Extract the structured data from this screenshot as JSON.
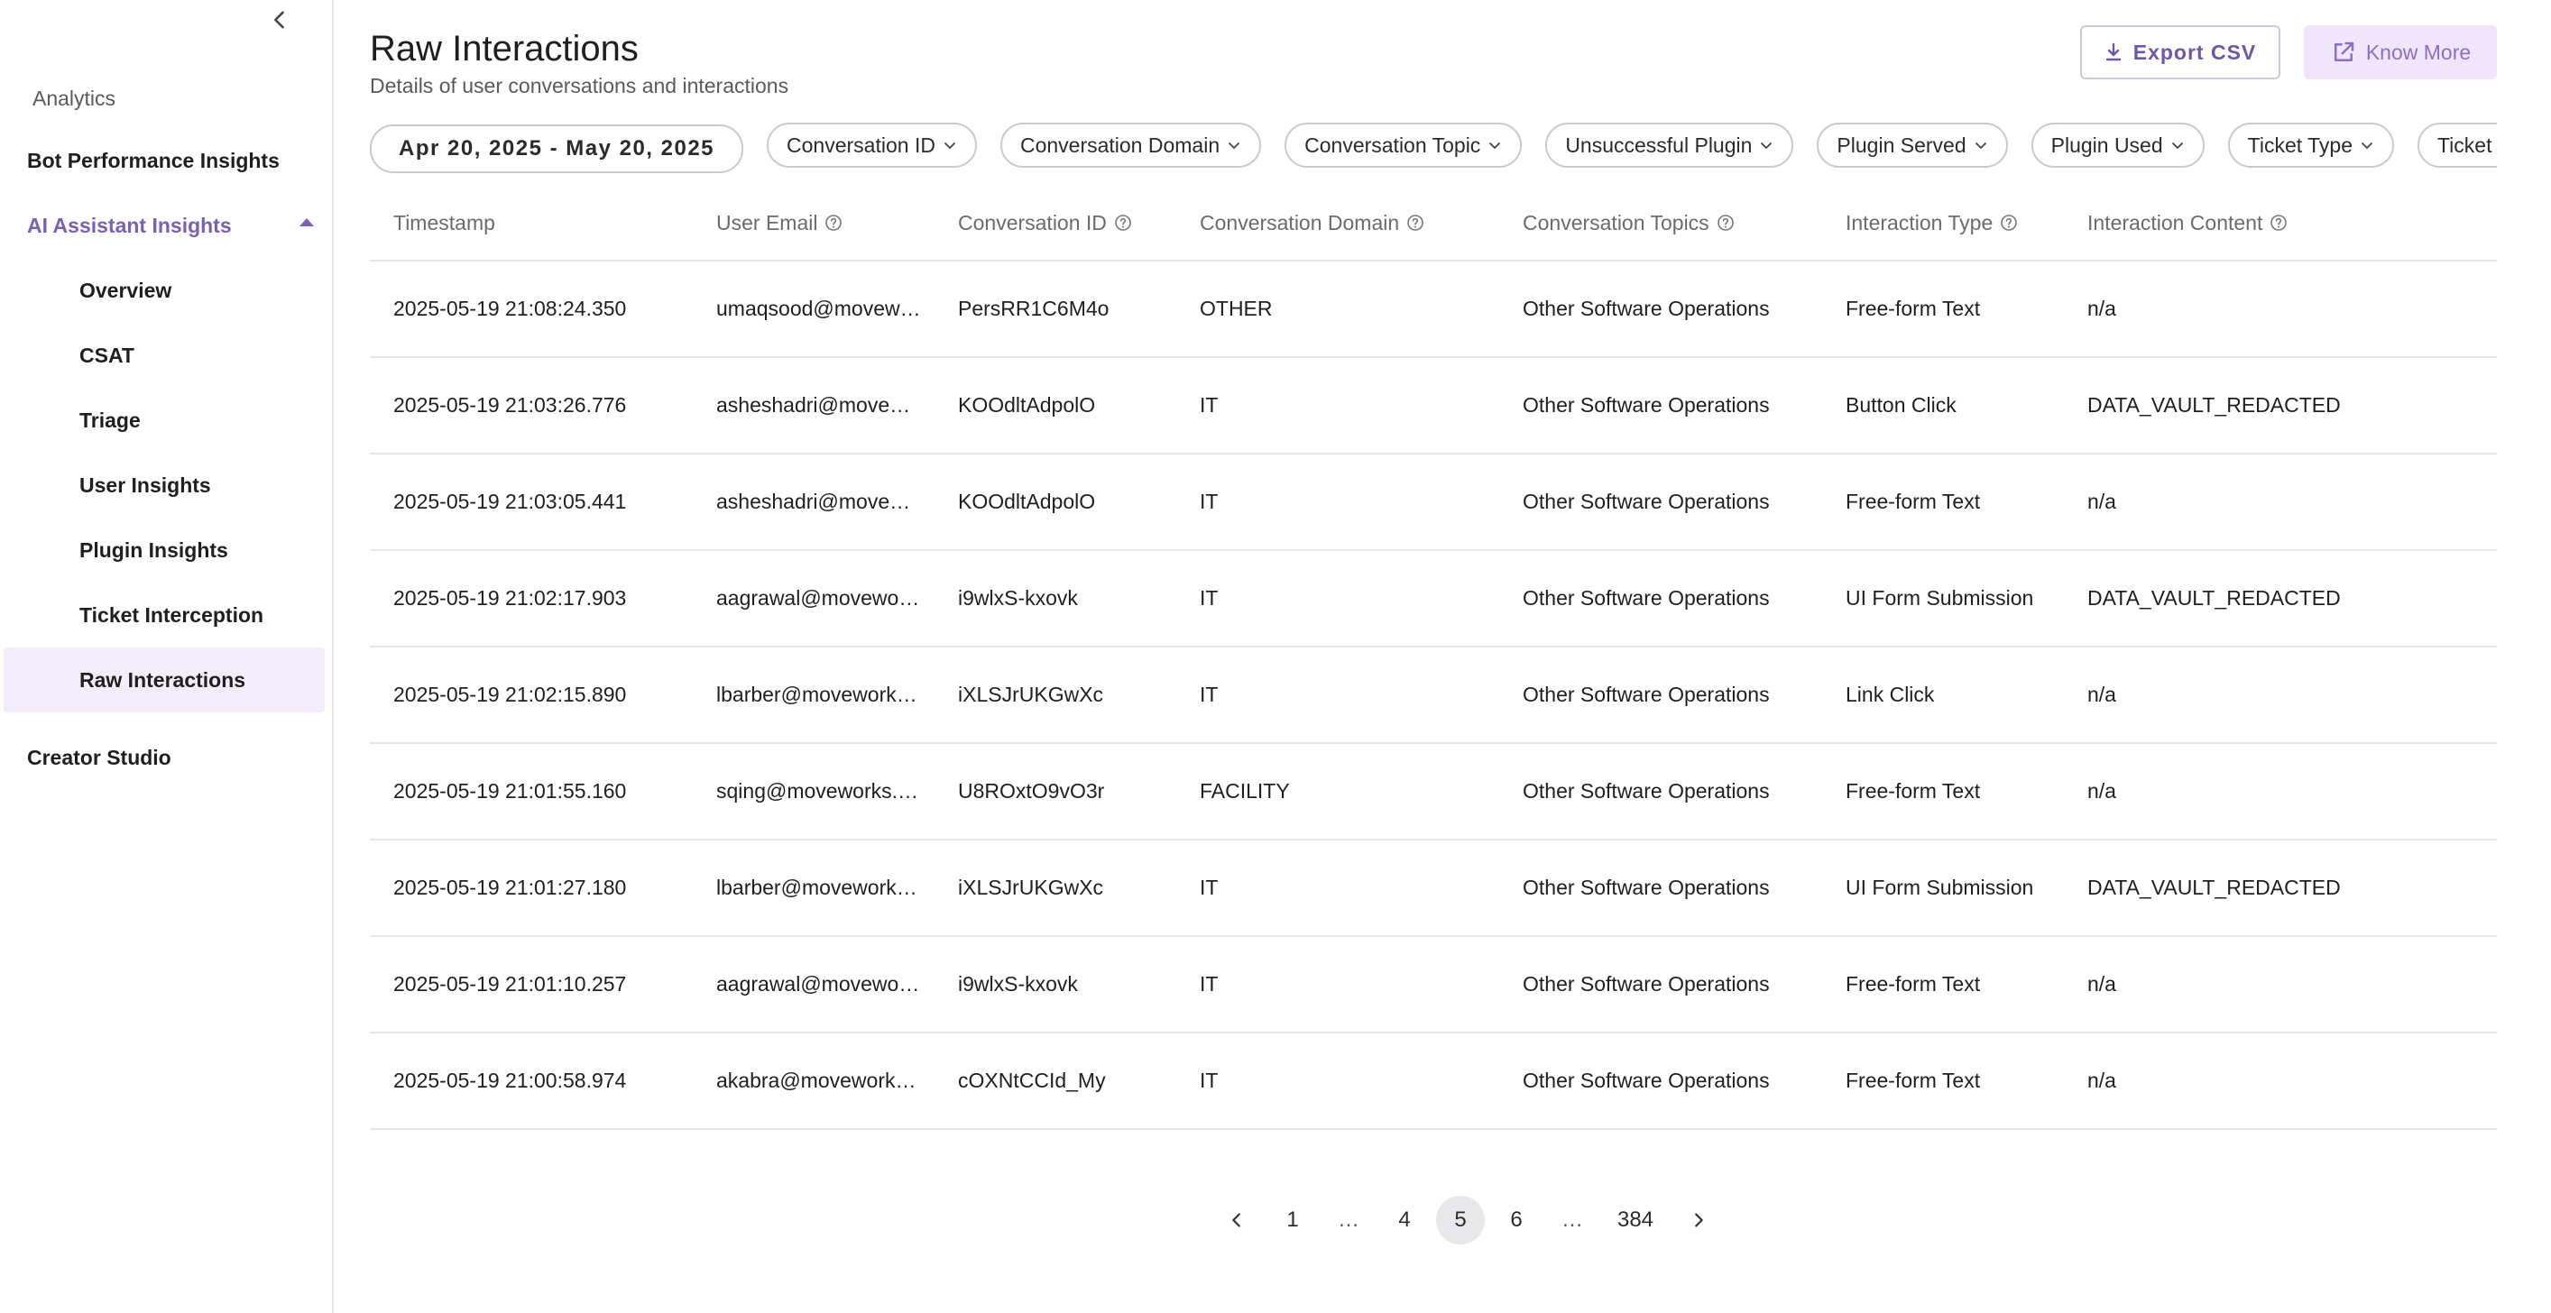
{
  "sidebar": {
    "section_label": "Analytics",
    "items": [
      {
        "label": "Bot Performance Insights"
      },
      {
        "label": "AI Assistant Insights"
      },
      {
        "label": "Overview"
      },
      {
        "label": "CSAT"
      },
      {
        "label": "Triage"
      },
      {
        "label": "User Insights"
      },
      {
        "label": "Plugin Insights"
      },
      {
        "label": "Ticket Interception"
      },
      {
        "label": "Raw Interactions"
      },
      {
        "label": "Creator Studio"
      }
    ],
    "active_item": "Raw Interactions",
    "accent_color": "#7b5fb3"
  },
  "header": {
    "title": "Raw Interactions",
    "subtitle": "Details of user conversations and interactions",
    "export_label": "Export CSV",
    "know_more_label": "Know More"
  },
  "filters": {
    "date_range": "Apr 20, 2025 - May 20, 2025",
    "chips": [
      "Conversation ID",
      "Conversation Domain",
      "Conversation Topic",
      "Unsuccessful Plugin",
      "Plugin Served",
      "Plugin Used",
      "Ticket Type",
      "Ticket ID"
    ]
  },
  "table": {
    "columns": [
      "Timestamp",
      "User Email",
      "Conversation ID",
      "Conversation Domain",
      "Conversation Topics",
      "Interaction Type",
      "Interaction Content"
    ],
    "rows": [
      [
        "2025-05-19 21:08:24.350",
        "umaqsood@moveworks.com",
        "PersRR1C6M4o",
        "OTHER",
        "Other Software Operations",
        "Free-form Text",
        "n/a"
      ],
      [
        "2025-05-19 21:03:26.776",
        "asheshadri@moveworks.com",
        "KOOdltAdpolO",
        "IT",
        "Other Software Operations",
        "Button Click",
        "DATA_VAULT_REDACTED"
      ],
      [
        "2025-05-19 21:03:05.441",
        "asheshadri@moveworks.com",
        "KOOdltAdpolO",
        "IT",
        "Other Software Operations",
        "Free-form Text",
        "n/a"
      ],
      [
        "2025-05-19 21:02:17.903",
        "aagrawal@moveworks.com",
        "i9wlxS-kxovk",
        "IT",
        "Other Software Operations",
        "UI Form Submission",
        "DATA_VAULT_REDACTED"
      ],
      [
        "2025-05-19 21:02:15.890",
        "lbarber@moveworks.com",
        "iXLSJrUKGwXc",
        "IT",
        "Other Software Operations",
        "Link Click",
        "n/a"
      ],
      [
        "2025-05-19 21:01:55.160",
        "sqing@moveworks.com",
        "U8ROxtO9vO3r",
        "FACILITY",
        "Other Software Operations",
        "Free-form Text",
        "n/a"
      ],
      [
        "2025-05-19 21:01:27.180",
        "lbarber@moveworks.com",
        "iXLSJrUKGwXc",
        "IT",
        "Other Software Operations",
        "UI Form Submission",
        "DATA_VAULT_REDACTED"
      ],
      [
        "2025-05-19 21:01:10.257",
        "aagrawal@moveworks.com",
        "i9wlxS-kxovk",
        "IT",
        "Other Software Operations",
        "Free-form Text",
        "n/a"
      ],
      [
        "2025-05-19 21:00:58.974",
        "akabra@moveworks.com",
        "cOXNtCCId_My",
        "IT",
        "Other Software Operations",
        "Free-form Text",
        "n/a"
      ]
    ]
  },
  "pagination": {
    "pages": [
      "1",
      "…",
      "4",
      "5",
      "6",
      "…",
      "384"
    ],
    "current": "5"
  },
  "icons": {
    "collapse": "chevron-left-icon",
    "export": "download-icon",
    "know_more": "external-link-icon",
    "chip_chevron": "chevron-down-icon",
    "header_help": "help-circle-icon",
    "prev": "chevron-left-icon",
    "next": "chevron-right-icon"
  }
}
